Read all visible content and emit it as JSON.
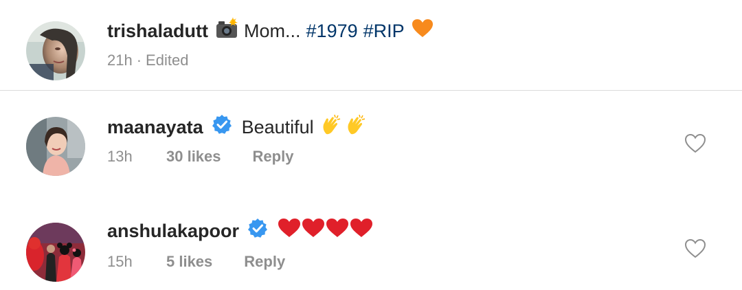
{
  "post": {
    "username": "trishaladutt",
    "camera_icon": "camera-flash-icon",
    "text": "Mom...",
    "hashtags": [
      "#1979",
      "#RIP"
    ],
    "end_emoji": "orange-heart-icon",
    "time": "21h",
    "separator": "·",
    "edited": "Edited"
  },
  "comments": [
    {
      "username": "maanayata",
      "verified": true,
      "text": "Beautiful",
      "emojis": [
        "clapping-hands-icon",
        "clapping-hands-icon"
      ],
      "time": "13h",
      "likes": "30 likes",
      "reply": "Reply",
      "like_icon": "heart-outline-icon"
    },
    {
      "username": "anshulakapoor",
      "verified": true,
      "text": "",
      "emojis": [
        "red-heart-icon",
        "red-heart-icon",
        "red-heart-icon",
        "red-heart-icon"
      ],
      "time": "15h",
      "likes": "5 likes",
      "reply": "Reply",
      "like_icon": "heart-outline-icon"
    }
  ],
  "colors": {
    "text": "#262626",
    "secondary": "#8e8e8e",
    "hashtag": "#003569",
    "verified": "#3897f0",
    "divider": "#dbdbdb",
    "red_heart": "#e0202a",
    "orange_heart": "#f78a1d"
  }
}
